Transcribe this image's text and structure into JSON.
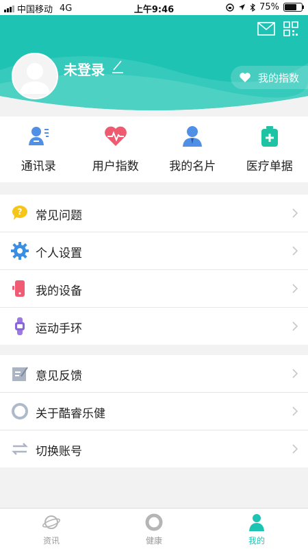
{
  "status_bar": {
    "carrier": "中国移动",
    "network": "4G",
    "time": "上午9:46",
    "battery": "75%",
    "battery_level": 0.75
  },
  "header": {
    "title": "未登录",
    "my_index_label": "我的指数",
    "icons": [
      "mail-icon",
      "qr-code-icon",
      "edit-icon",
      "heart-icon"
    ],
    "colors": {
      "teal": "#1ec3b3",
      "teal_light": "#5fd8cc"
    }
  },
  "quick_actions": [
    {
      "label": "通讯录",
      "icon": "contacts-icon"
    },
    {
      "label": "用户指数",
      "icon": "heart-pulse-icon"
    },
    {
      "label": "我的名片",
      "icon": "business-card-icon"
    },
    {
      "label": "医疗单据",
      "icon": "medical-kit-icon"
    }
  ],
  "menu_group_1": [
    {
      "label": "常见问题",
      "icon": "question-icon"
    },
    {
      "label": "个人设置",
      "icon": "gear-icon"
    },
    {
      "label": "我的设备",
      "icon": "device-icon"
    },
    {
      "label": "运动手环",
      "icon": "wristband-icon"
    }
  ],
  "menu_group_2": [
    {
      "label": "意见反馈",
      "icon": "feedback-icon"
    },
    {
      "label": "关于酷睿乐健",
      "icon": "about-icon"
    },
    {
      "label": "切换账号",
      "icon": "switch-account-icon"
    }
  ],
  "tabs": [
    {
      "label": "资讯",
      "icon": "planet-icon",
      "active": false
    },
    {
      "label": "健康",
      "icon": "ring-icon",
      "active": false
    },
    {
      "label": "我的",
      "icon": "person-icon",
      "active": true
    }
  ]
}
